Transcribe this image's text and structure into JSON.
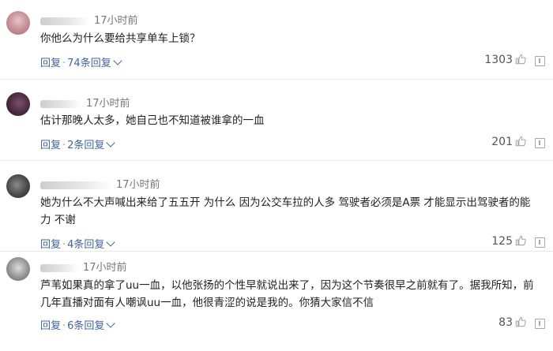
{
  "comments": [
    {
      "time": "17小时前",
      "text": "你他么为什么要给共享单车上锁？",
      "reply_label": "回复",
      "sep": "·",
      "replies": "74条回复",
      "likes": "1303"
    },
    {
      "time": "17小时前",
      "text": "估计那晚人太多，她自己也不知道被谁拿的一血",
      "reply_label": "回复",
      "sep": "·",
      "replies": "2条回复",
      "likes": "201"
    },
    {
      "time": "17小时前",
      "text": "她为什么不大声喊出来给了五五开 为什么 因为公交车拉的人多 驾驶者必须是A票 才能显示出驾驶者的能力 不谢",
      "reply_label": "回复",
      "sep": "·",
      "replies": "4条回复",
      "likes": "125"
    },
    {
      "time": "17小时前",
      "text": "芦苇如果真的拿了uu一血，以他张扬的个性早就说出来了，因为这个节奏很早之前就有了。据我所知，前几年直播对面有人嘲讽uu一血，他很青涩的说是我的。你猜大家信不信",
      "reply_label": "回复",
      "sep": "·",
      "replies": "6条回复",
      "likes": "83"
    }
  ],
  "colors": {
    "link": "#406599",
    "text": "#222222",
    "meta": "#777777"
  },
  "icons": {
    "like": "thumbs-up-icon",
    "report": "report-icon"
  }
}
